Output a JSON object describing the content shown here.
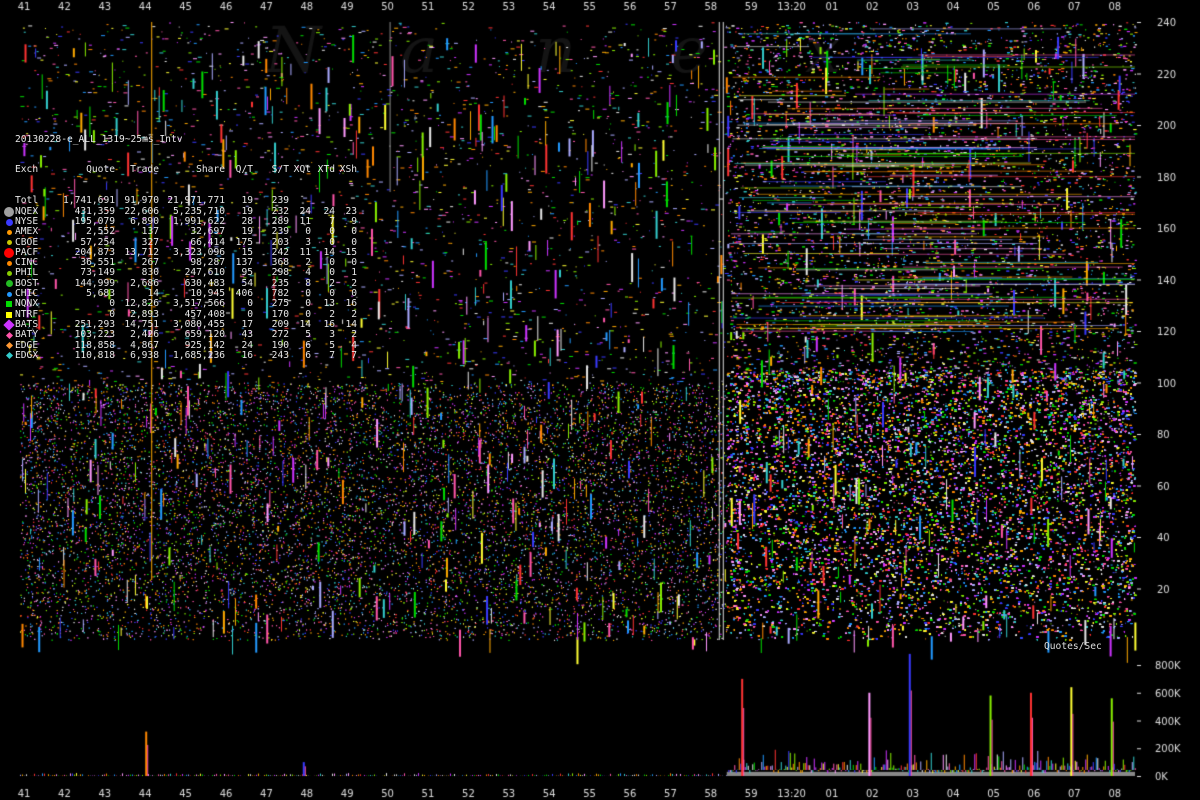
{
  "watermark": "Nanex",
  "chart_data": [
    {
      "type": "scatter",
      "title": "",
      "x_ticks": [
        "41",
        "42",
        "43",
        "44",
        "45",
        "46",
        "47",
        "48",
        "49",
        "50",
        "51",
        "52",
        "53",
        "54",
        "55",
        "56",
        "57",
        "58",
        "59",
        "13:20",
        "01",
        "02",
        "03",
        "04",
        "05",
        "06",
        "07",
        "08"
      ],
      "y_ticks": [
        20,
        40,
        60,
        80,
        100,
        120,
        140,
        160,
        180,
        200,
        220,
        240
      ],
      "ylim": [
        0,
        240
      ],
      "regime_change_tick": "58",
      "background": "#000000"
    },
    {
      "type": "area",
      "label": "Quotes/Sec",
      "y_ticks": [
        "0K",
        "200K",
        "400K",
        "600K",
        "800K"
      ],
      "ylim": [
        0,
        800
      ],
      "spikes": [
        {
          "x": "44",
          "value": 320
        },
        {
          "x": "48",
          "value": 100
        },
        {
          "x": "59",
          "value": 700
        },
        {
          "x": "02",
          "value": 600
        },
        {
          "x": "03",
          "value": 880
        },
        {
          "x": "05",
          "value": 580
        },
        {
          "x": "06",
          "value": 600
        },
        {
          "x": "07",
          "value": 640
        },
        {
          "x": "08",
          "value": 560
        }
      ]
    }
  ],
  "stats": {
    "title": "20130228-e_ALL_1319~25ms_Intv",
    "headers": {
      "exch": "Exch",
      "quote": "Quote",
      "trade": "Trade",
      "share": "Share",
      "qt": "Q/T",
      "st": "S/T",
      "xqt": "XQt",
      "xtd": "XTd",
      "xsh": "XSh"
    },
    "rows": [
      {
        "exch": "Totl",
        "quote": "1,741,691",
        "trade": "91,970",
        "share": "21,971,771",
        "qt": "19",
        "st": "239",
        "xqt": "",
        "xtd": "",
        "xsh": "",
        "marker": "none",
        "color": "#ffffff"
      },
      {
        "exch": "NQEX",
        "quote": "431,359",
        "trade": "22,606",
        "share": "5,235,710",
        "qt": "19",
        "st": "232",
        "xqt": "24",
        "xtd": "24",
        "xsh": "23",
        "marker": "bigdot",
        "color": "#a0a0a0"
      },
      {
        "exch": "NYSE",
        "quote": "195,079",
        "trade": "6,890",
        "share": "1,991,622",
        "qt": "28",
        "st": "289",
        "xqt": "11",
        "xtd": "7",
        "xsh": "9",
        "marker": "dot",
        "color": "#3a3aff"
      },
      {
        "exch": "AMEX",
        "quote": "2,552",
        "trade": "137",
        "share": "32,697",
        "qt": "19",
        "st": "239",
        "xqt": "0",
        "xtd": "0",
        "xsh": "0",
        "marker": "smalldot",
        "color": "#ff9900"
      },
      {
        "exch": "CBOE",
        "quote": "57,254",
        "trade": "327",
        "share": "66,414",
        "qt": "175",
        "st": "203",
        "xqt": "3",
        "xtd": "0",
        "xsh": "0",
        "marker": "smalldot",
        "color": "#c8c800"
      },
      {
        "exch": "PACF",
        "quote": "204,873",
        "trade": "13,712",
        "share": "3,323,096",
        "qt": "15",
        "st": "242",
        "xqt": "11",
        "xtd": "14",
        "xsh": "15",
        "marker": "bigdot",
        "color": "#ff0000"
      },
      {
        "exch": "CINC",
        "quote": "36,551",
        "trade": "267",
        "share": "98,287",
        "qt": "137",
        "st": "368",
        "xqt": "2",
        "xtd": "0",
        "xsh": "0",
        "marker": "smalldot",
        "color": "#ff8800"
      },
      {
        "exch": "PHIL",
        "quote": "73,149",
        "trade": "830",
        "share": "247,610",
        "qt": "95",
        "st": "298",
        "xqt": "4",
        "xtd": "0",
        "xsh": "1",
        "marker": "smalldot",
        "color": "#88cc00"
      },
      {
        "exch": "BOST",
        "quote": "144,999",
        "trade": "2,686",
        "share": "630,483",
        "qt": "54",
        "st": "235",
        "xqt": "8",
        "xtd": "2",
        "xsh": "2",
        "marker": "dot",
        "color": "#22bb22"
      },
      {
        "exch": "CHIC",
        "quote": "5,683",
        "trade": "14",
        "share": "10,945",
        "qt": "406",
        "st": "782",
        "xqt": "0",
        "xtd": "0",
        "xsh": "0",
        "marker": "smalldot",
        "color": "#2299ff"
      },
      {
        "exch": "NQNX",
        "quote": "0",
        "trade": "12,826",
        "share": "3,517,566",
        "qt": "0",
        "st": "275",
        "xqt": "0",
        "xtd": "13",
        "xsh": "16",
        "marker": "square",
        "color": "#00dd00"
      },
      {
        "exch": "NTRF",
        "quote": "0",
        "trade": "2,893",
        "share": "457,408",
        "qt": "0",
        "st": "170",
        "xqt": "0",
        "xtd": "2",
        "xsh": "2",
        "marker": "square",
        "color": "#ffff00"
      },
      {
        "exch": "BATS",
        "quote": "251,293",
        "trade": "14,751",
        "share": "3,080,455",
        "qt": "17",
        "st": "209",
        "xqt": "14",
        "xtd": "16",
        "xsh": "14",
        "marker": "bigdiamond",
        "color": "#cc33ff"
      },
      {
        "exch": "BATY",
        "quote": "103,223",
        "trade": "2,426",
        "share": "659,120",
        "qt": "43",
        "st": "272",
        "xqt": "5",
        "xtd": "3",
        "xsh": "2",
        "marker": "diamond",
        "color": "#ff55aa"
      },
      {
        "exch": "EDGE",
        "quote": "118,858",
        "trade": "4,867",
        "share": "925,142",
        "qt": "24",
        "st": "190",
        "xqt": "6",
        "xtd": "5",
        "xsh": "4",
        "marker": "diamond",
        "color": "#ff9933"
      },
      {
        "exch": "EDGX",
        "quote": "110,818",
        "trade": "6,938",
        "share": "1,685,236",
        "qt": "16",
        "st": "243",
        "xqt": "6",
        "xtd": "7",
        "xsh": "7",
        "marker": "diamond",
        "color": "#33cccc"
      }
    ]
  }
}
